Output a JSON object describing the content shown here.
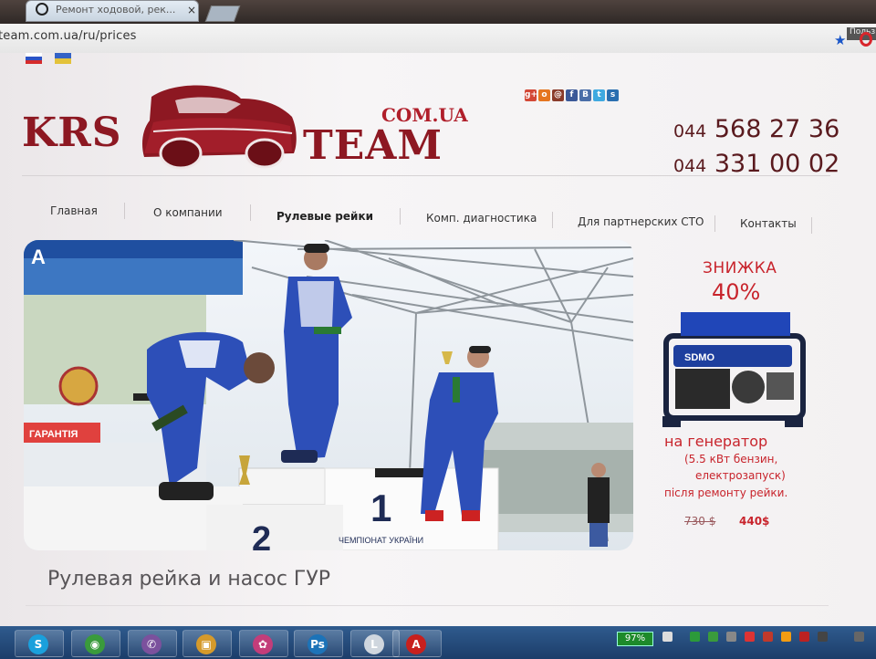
{
  "browser": {
    "tab_title": "Ремонт ходовой, рек...",
    "tab_close": "×",
    "url": "team.com.ua/ru/prices",
    "user_badge": "Польз"
  },
  "site": {
    "logo_left": "KRS",
    "logo_right": "TEAM",
    "logo_suffix": "COM.UA",
    "brand_color": "#8d1822",
    "phones": [
      {
        "prefix": "044",
        "number": "568 27 36"
      },
      {
        "prefix": "044",
        "number": "331 00 02"
      }
    ],
    "social_icons": [
      {
        "name": "google-plus-icon",
        "glyph": "g+",
        "color": "#d34836"
      },
      {
        "name": "odnoklassniki-icon",
        "glyph": "о",
        "color": "#e5751f"
      },
      {
        "name": "mail-ru-icon",
        "glyph": "@",
        "color": "#8a3b2a"
      },
      {
        "name": "facebook-icon",
        "glyph": "f",
        "color": "#3b5998"
      },
      {
        "name": "vkontakte-icon",
        "glyph": "B",
        "color": "#4a6ea8"
      },
      {
        "name": "twitter-icon",
        "glyph": "t",
        "color": "#3fa9e0"
      },
      {
        "name": "skype-icon",
        "glyph": "s",
        "color": "#2a6fb0"
      }
    ]
  },
  "nav": {
    "items": [
      {
        "label": "Главная",
        "active": false
      },
      {
        "label": "О компании",
        "active": false
      },
      {
        "label": "Рулевые рейки",
        "active": true
      },
      {
        "label": "Комп. диагностика",
        "active": false
      },
      {
        "label": "Для партнерских СТО",
        "active": false
      },
      {
        "label": "Контакты",
        "active": false
      }
    ]
  },
  "hero": {
    "banner_text": "ГАРАНТІЯ",
    "podium_place_1": "1",
    "podium_place_2": "2",
    "podium_caption": "ЧЕМПІОНАТ УКРАЇНИ"
  },
  "promo": {
    "title": "ЗНИЖКА",
    "percent": "40%",
    "generator_brand": "SDMO",
    "line1": "на генератор",
    "line2": "(5.5 кВт бензин,",
    "line3": "електрозапуск)",
    "line4": "після ремонту рейки.",
    "price_old": "730 $",
    "price_new": "440$"
  },
  "page": {
    "heading": "Рулевая рейка и насос ГУР"
  },
  "taskbar": {
    "battery": "97%",
    "apps": [
      {
        "name": "skype-icon",
        "glyph": "S",
        "color": "#1aa0dc"
      },
      {
        "name": "chrome-icon",
        "glyph": "◉",
        "color": "#3a9b3c"
      },
      {
        "name": "viber-icon",
        "glyph": "✆",
        "color": "#7b519d"
      },
      {
        "name": "files-icon",
        "glyph": "▣",
        "color": "#d59a2b"
      },
      {
        "name": "picasa-icon",
        "glyph": "✿",
        "color": "#c33d7a"
      },
      {
        "name": "photoshop-icon",
        "glyph": "Ps",
        "color": "#1c73b8"
      },
      {
        "name": "lync-icon",
        "glyph": "L",
        "color": "#cfd6de"
      },
      {
        "name": "acrobat-icon",
        "glyph": "A",
        "color": "#c8201e"
      }
    ]
  }
}
